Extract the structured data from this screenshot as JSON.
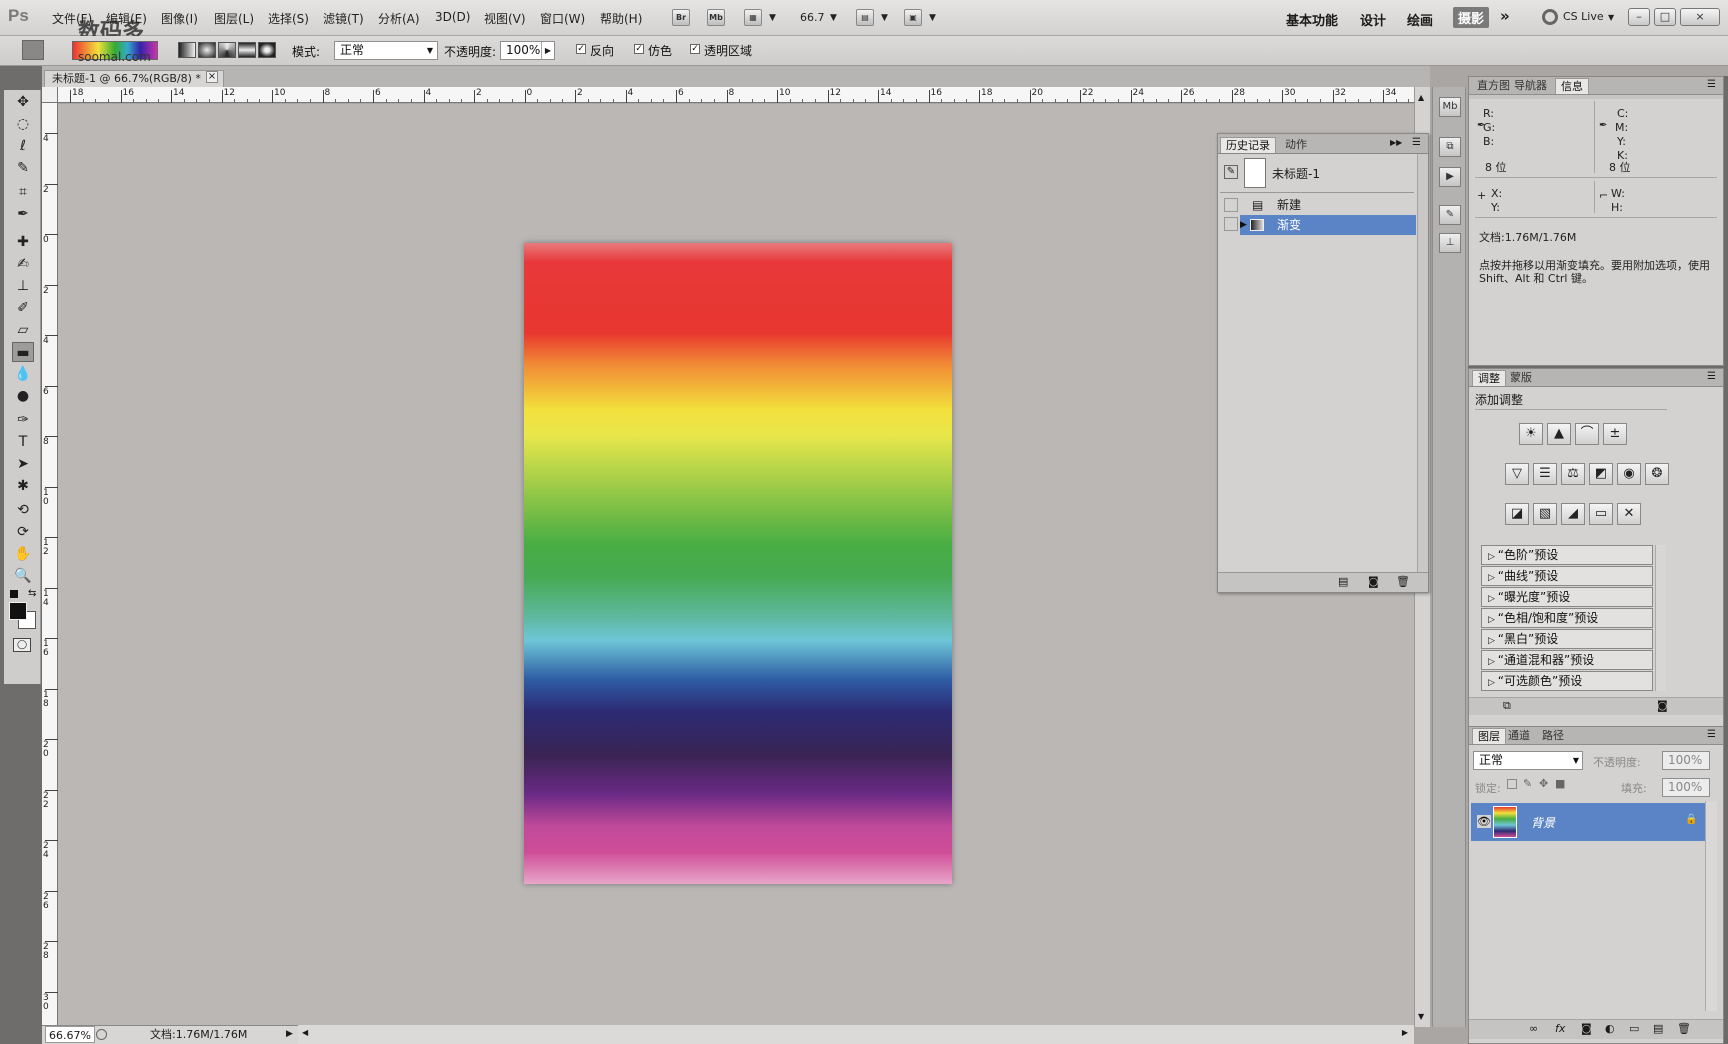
{
  "app": {
    "logo": "Ps",
    "watermark": "数码多",
    "watermark_site": "soomal.com"
  },
  "menu": [
    "文件(F)",
    "编辑(E)",
    "图像(I)",
    "图层(L)",
    "选择(S)",
    "滤镜(T)",
    "分析(A)",
    "3D(D)",
    "视图(V)",
    "窗口(W)",
    "帮助(H)"
  ],
  "appbar": {
    "br": "Br",
    "mb": "Mb",
    "zoom": "66.7"
  },
  "workspaces": [
    "基本功能",
    "设计",
    "绘画",
    "摄影"
  ],
  "cslive": "CS Live",
  "window_buttons": [
    "–",
    "□",
    "×"
  ],
  "options": {
    "mode_label": "模式:",
    "mode_value": "正常",
    "opacity_label": "不透明度:",
    "opacity_value": "100%",
    "reverse": "反向",
    "dither": "仿色",
    "transparency": "透明区域"
  },
  "document": {
    "tab_title": "未标题-1 @ 66.7%(RGB/8) *"
  },
  "ruler_h": [
    "18",
    "16",
    "14",
    "12",
    "10",
    "8",
    "6",
    "4",
    "2",
    "0",
    "2",
    "4",
    "6",
    "8",
    "10",
    "12",
    "14",
    "16",
    "18",
    "20",
    "22",
    "24",
    "26",
    "28",
    "30",
    "32",
    "34"
  ],
  "ruler_v": [
    "4",
    "2",
    "0",
    "2",
    "4",
    "6",
    "8",
    "1 0",
    "1 2",
    "1 4",
    "1 6",
    "1 8",
    "2 0",
    "2 2",
    "2 4",
    "2 6",
    "2 8",
    "3 0"
  ],
  "status": {
    "zoom": "66.67%",
    "doc": "文档:1.76M/1.76M"
  },
  "history": {
    "tabs": [
      "历史记录",
      "动作"
    ],
    "snapshot": "未标题-1",
    "items": [
      "新建",
      "渐变"
    ]
  },
  "info_panel": {
    "tabs": [
      "直方图",
      "导航器",
      "信息"
    ],
    "rgb": [
      "R:",
      "G:",
      "B:"
    ],
    "cmyk": [
      "C:",
      "M:",
      "Y:",
      "K:"
    ],
    "bits_left": "8 位",
    "bits_right": "8 位",
    "xy": [
      "X:",
      "Y:"
    ],
    "wh": [
      "W:",
      "H:"
    ],
    "doc": "文档:1.76M/1.76M",
    "hint": "点按并拖移以用渐变填充。要用附加选项，使用 Shift、Alt 和 Ctrl 键。"
  },
  "adjust_panel": {
    "tabs": [
      "调整",
      "蒙版"
    ],
    "title": "添加调整",
    "presets": [
      "“色阶”预设",
      "“曲线”预设",
      "“曝光度”预设",
      "“色相/饱和度”预设",
      "“黑白”预设",
      "“通道混和器”预设",
      "“可选颜色”预设"
    ]
  },
  "layers_panel": {
    "tabs": [
      "图层",
      "通道",
      "路径"
    ],
    "blend": "正常",
    "opacity_label": "不透明度:",
    "opacity": "100%",
    "lock_label": "锁定:",
    "fill_label": "填充:",
    "fill": "100%",
    "layer_name": "背景"
  }
}
